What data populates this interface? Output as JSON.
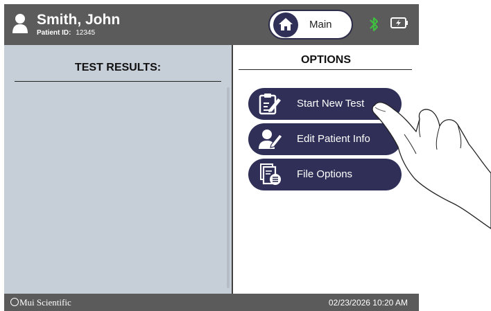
{
  "header": {
    "patient_name": "Smith, John",
    "patient_id_label": "Patient ID:",
    "patient_id": "12345",
    "main_button_label": "Main",
    "bluetooth_color": "#3fbf3f"
  },
  "left_panel": {
    "title": "TEST RESULTS:"
  },
  "options": {
    "title": "OPTIONS",
    "items": [
      {
        "label": "Start New Test",
        "icon": "clipboard-edit-icon"
      },
      {
        "label": "Edit Patient Info",
        "icon": "user-edit-icon"
      },
      {
        "label": "File Options",
        "icon": "file-list-icon"
      }
    ]
  },
  "footer": {
    "brand": "Mui Scientific",
    "datetime": "02/23/2026 10:20 AM"
  },
  "colors": {
    "header_bg": "#5b5b5b",
    "button_bg": "#2f2f57",
    "results_bg": "#c6ced8"
  }
}
